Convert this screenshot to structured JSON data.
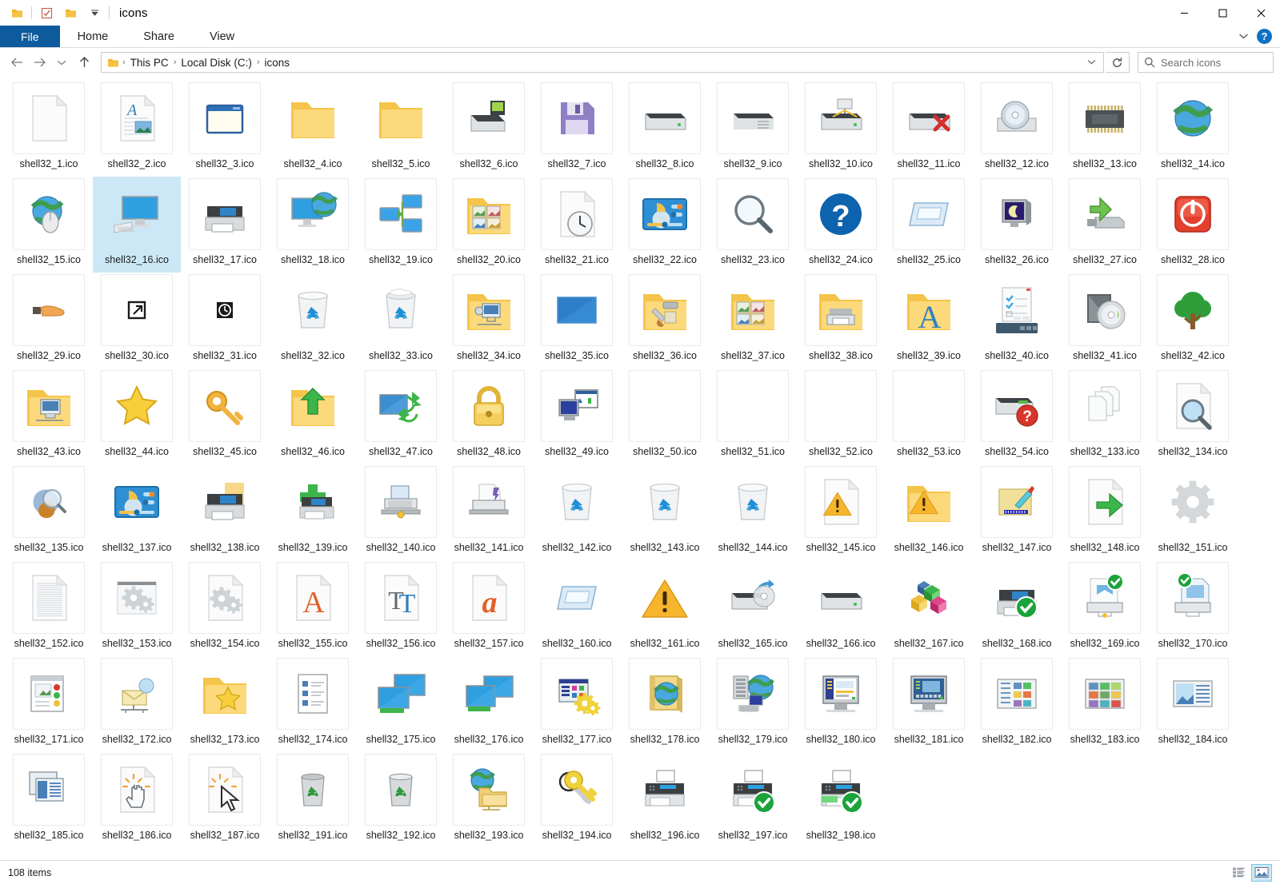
{
  "window": {
    "title": "icons",
    "quick_access": [
      "folder-icon",
      "properties-icon",
      "new-folder-icon",
      "customize-dropdown-icon"
    ],
    "controls": {
      "minimize": "minimize-icon",
      "maximize": "maximize-icon",
      "close": "close-icon"
    }
  },
  "ribbon": {
    "tabs": [
      {
        "label": "File",
        "active": true
      },
      {
        "label": "Home",
        "active": false
      },
      {
        "label": "Share",
        "active": false
      },
      {
        "label": "View",
        "active": false
      }
    ],
    "collapse_icon": "chevron-down-icon",
    "help_label": "?"
  },
  "address": {
    "back_icon": "arrow-left-icon",
    "forward_icon": "arrow-right-icon",
    "recent_icon": "chevron-down-icon",
    "up_icon": "arrow-up-icon",
    "breadcrumb": [
      "This PC",
      "Local Disk (C:)",
      "icons"
    ],
    "breadcrumb_separator": "›",
    "dropdown_icon": "chevron-down-icon",
    "refresh_icon": "refresh-icon"
  },
  "search": {
    "placeholder": "Search icons",
    "icon": "search-icon",
    "value": ""
  },
  "status": {
    "item_count": "108 items",
    "views": [
      {
        "name": "details-view",
        "selected": false
      },
      {
        "name": "large-icons-view",
        "selected": true
      }
    ]
  },
  "files": [
    {
      "label": "shell32_1.ico",
      "icon": "blank-document",
      "selected": false
    },
    {
      "label": "shell32_2.ico",
      "icon": "document-with-text",
      "selected": false
    },
    {
      "label": "shell32_3.ico",
      "icon": "application-window",
      "selected": false
    },
    {
      "label": "shell32_4.ico",
      "icon": "folder-closed",
      "selected": false,
      "nobox": true
    },
    {
      "label": "shell32_5.ico",
      "icon": "folder-closed",
      "selected": false,
      "nobox": true
    },
    {
      "label": "shell32_6.ico",
      "icon": "drive-network",
      "selected": false
    },
    {
      "label": "shell32_7.ico",
      "icon": "floppy-disk",
      "selected": false
    },
    {
      "label": "shell32_8.ico",
      "icon": "hard-drive",
      "selected": false
    },
    {
      "label": "shell32_9.ico",
      "icon": "drive-removable",
      "selected": false
    },
    {
      "label": "shell32_10.ico",
      "icon": "drive-network-share",
      "selected": false
    },
    {
      "label": "shell32_11.ico",
      "icon": "drive-disconnected",
      "selected": false
    },
    {
      "label": "shell32_12.ico",
      "icon": "cd-drive",
      "selected": false
    },
    {
      "label": "shell32_13.ico",
      "icon": "ram-chip",
      "selected": false
    },
    {
      "label": "shell32_14.ico",
      "icon": "globe-internet",
      "selected": false
    },
    {
      "label": "shell32_15.ico",
      "icon": "globe-mouse",
      "selected": false
    },
    {
      "label": "shell32_16.ico",
      "icon": "computer-desktop",
      "selected": true
    },
    {
      "label": "shell32_17.ico",
      "icon": "printer",
      "selected": false
    },
    {
      "label": "shell32_18.ico",
      "icon": "monitor-globe",
      "selected": false
    },
    {
      "label": "shell32_19.ico",
      "icon": "network-screens",
      "selected": false
    },
    {
      "label": "shell32_20.ico",
      "icon": "pictures-folder",
      "selected": false
    },
    {
      "label": "shell32_21.ico",
      "icon": "document-clock",
      "selected": false
    },
    {
      "label": "shell32_22.ico",
      "icon": "control-panel",
      "selected": false
    },
    {
      "label": "shell32_23.ico",
      "icon": "magnifier",
      "selected": false
    },
    {
      "label": "shell32_24.ico",
      "icon": "help-question",
      "selected": false
    },
    {
      "label": "shell32_25.ico",
      "icon": "window-faded",
      "selected": false
    },
    {
      "label": "shell32_26.ico",
      "icon": "monitor-screensaver",
      "selected": false
    },
    {
      "label": "shell32_27.ico",
      "icon": "usb-eject",
      "selected": false
    },
    {
      "label": "shell32_28.ico",
      "icon": "shutdown-power",
      "selected": false
    },
    {
      "label": "shell32_29.ico",
      "icon": "hand-offer",
      "selected": false
    },
    {
      "label": "shell32_30.ico",
      "icon": "shortcut-arrow",
      "selected": false
    },
    {
      "label": "shell32_31.ico",
      "icon": "clock-overlay",
      "selected": false
    },
    {
      "label": "shell32_32.ico",
      "icon": "recycle-empty",
      "selected": false,
      "nobox": true
    },
    {
      "label": "shell32_33.ico",
      "icon": "recycle-full",
      "selected": false,
      "nobox": true
    },
    {
      "label": "shell32_34.ico",
      "icon": "folder-network",
      "selected": false
    },
    {
      "label": "shell32_35.ico",
      "icon": "blue-screen",
      "selected": false
    },
    {
      "label": "shell32_36.ico",
      "icon": "folder-tools",
      "selected": false
    },
    {
      "label": "shell32_37.ico",
      "icon": "pictures-folder",
      "selected": false,
      "nobox": true
    },
    {
      "label": "shell32_38.ico",
      "icon": "folder-printer",
      "selected": false
    },
    {
      "label": "shell32_39.ico",
      "icon": "folder-fonts",
      "selected": false,
      "nobox": true
    },
    {
      "label": "shell32_40.ico",
      "icon": "dialog-taskbar",
      "selected": false,
      "nobox": true
    },
    {
      "label": "shell32_41.ico",
      "icon": "software-cd",
      "selected": false
    },
    {
      "label": "shell32_42.ico",
      "icon": "tree",
      "selected": false
    },
    {
      "label": "shell32_43.ico",
      "icon": "folder-computer",
      "selected": false
    },
    {
      "label": "shell32_44.ico",
      "icon": "star-favorites",
      "selected": false
    },
    {
      "label": "shell32_45.ico",
      "icon": "key-gold",
      "selected": false
    },
    {
      "label": "shell32_46.ico",
      "icon": "folder-up-arrow",
      "selected": false,
      "nobox": true
    },
    {
      "label": "shell32_47.ico",
      "icon": "sync-screens",
      "selected": false
    },
    {
      "label": "shell32_48.ico",
      "icon": "padlock",
      "selected": false
    },
    {
      "label": "shell32_49.ico",
      "icon": "computer-window",
      "selected": false
    },
    {
      "label": "shell32_50.ico",
      "icon": "empty",
      "selected": false
    },
    {
      "label": "shell32_51.ico",
      "icon": "empty",
      "selected": false
    },
    {
      "label": "shell32_52.ico",
      "icon": "empty",
      "selected": false
    },
    {
      "label": "shell32_53.ico",
      "icon": "empty",
      "selected": false
    },
    {
      "label": "shell32_54.ico",
      "icon": "drive-question",
      "selected": false
    },
    {
      "label": "shell32_133.ico",
      "icon": "documents-stack",
      "selected": false
    },
    {
      "label": "shell32_134.ico",
      "icon": "document-search",
      "selected": false
    },
    {
      "label": "shell32_135.ico",
      "icon": "search-results",
      "selected": false
    },
    {
      "label": "shell32_137.ico",
      "icon": "control-panel",
      "selected": false,
      "nobox": true
    },
    {
      "label": "shell32_138.ico",
      "icon": "printer-folder",
      "selected": false,
      "nobox": true
    },
    {
      "label": "shell32_139.ico",
      "icon": "printer-add",
      "selected": false,
      "nobox": true
    },
    {
      "label": "shell32_140.ico",
      "icon": "printer-network",
      "selected": false
    },
    {
      "label": "shell32_141.ico",
      "icon": "printer-file",
      "selected": false
    },
    {
      "label": "shell32_142.ico",
      "icon": "recycle-empty",
      "selected": false,
      "nobox": true
    },
    {
      "label": "shell32_143.ico",
      "icon": "recycle-empty",
      "selected": false,
      "nobox": true
    },
    {
      "label": "shell32_144.ico",
      "icon": "recycle-empty",
      "selected": false,
      "nobox": true
    },
    {
      "label": "shell32_145.ico",
      "icon": "document-warning",
      "selected": false
    },
    {
      "label": "shell32_146.ico",
      "icon": "folder-warning",
      "selected": false,
      "nobox": true
    },
    {
      "label": "shell32_147.ico",
      "icon": "folder-paint",
      "selected": false
    },
    {
      "label": "shell32_148.ico",
      "icon": "document-green-arrow",
      "selected": false
    },
    {
      "label": "shell32_151.ico",
      "icon": "gear-large",
      "selected": false,
      "nobox": true
    },
    {
      "label": "shell32_152.ico",
      "icon": "text-document-lines",
      "selected": false
    },
    {
      "label": "shell32_153.ico",
      "icon": "gears-window",
      "selected": false
    },
    {
      "label": "shell32_154.ico",
      "icon": "gears-document",
      "selected": false
    },
    {
      "label": "shell32_155.ico",
      "icon": "font-file-a",
      "selected": false
    },
    {
      "label": "shell32_156.ico",
      "icon": "truetype-font",
      "selected": false
    },
    {
      "label": "shell32_157.ico",
      "icon": "font-file-lower-a",
      "selected": false
    },
    {
      "label": "shell32_160.ico",
      "icon": "window-faded",
      "selected": false,
      "nobox": true
    },
    {
      "label": "shell32_161.ico",
      "icon": "warning-triangle",
      "selected": false,
      "nobox": true
    },
    {
      "label": "shell32_165.ico",
      "icon": "drive-burn",
      "selected": false,
      "nobox": true
    },
    {
      "label": "shell32_166.ico",
      "icon": "hard-drive",
      "selected": false,
      "nobox": true
    },
    {
      "label": "shell32_167.ico",
      "icon": "colored-blocks",
      "selected": false,
      "nobox": true
    },
    {
      "label": "shell32_168.ico",
      "icon": "printer-check",
      "selected": false,
      "nobox": true
    },
    {
      "label": "shell32_169.ico",
      "icon": "printer-doc-check",
      "selected": false
    },
    {
      "label": "shell32_170.ico",
      "icon": "printer-doc-check2",
      "selected": false
    },
    {
      "label": "shell32_171.ico",
      "icon": "calendar-contacts",
      "selected": false
    },
    {
      "label": "shell32_172.ico",
      "icon": "network-mail",
      "selected": false
    },
    {
      "label": "shell32_173.ico",
      "icon": "folder-star",
      "selected": false,
      "nobox": true
    },
    {
      "label": "shell32_174.ico",
      "icon": "checklist-document",
      "selected": false
    },
    {
      "label": "shell32_175.ico",
      "icon": "screens-green",
      "selected": false,
      "nobox": true
    },
    {
      "label": "shell32_176.ico",
      "icon": "screens-green2",
      "selected": false,
      "nobox": true
    },
    {
      "label": "shell32_177.ico",
      "icon": "window-gears",
      "selected": false
    },
    {
      "label": "shell32_178.ico",
      "icon": "help-book-globe",
      "selected": false
    },
    {
      "label": "shell32_179.ico",
      "icon": "server-network",
      "selected": false
    },
    {
      "label": "shell32_180.ico",
      "icon": "monitor-app",
      "selected": false
    },
    {
      "label": "shell32_181.ico",
      "icon": "monitor-app-blue",
      "selected": false
    },
    {
      "label": "shell32_182.ico",
      "icon": "list-thumbnails",
      "selected": false
    },
    {
      "label": "shell32_183.ico",
      "icon": "grid-thumbnails",
      "selected": false
    },
    {
      "label": "shell32_184.ico",
      "icon": "preview-pane",
      "selected": false
    },
    {
      "label": "shell32_185.ico",
      "icon": "windows-stack",
      "selected": false
    },
    {
      "label": "shell32_186.ico",
      "icon": "document-hand-click",
      "selected": false
    },
    {
      "label": "shell32_187.ico",
      "icon": "document-cursor-click",
      "selected": false
    },
    {
      "label": "shell32_191.ico",
      "icon": "recycle-small-empty",
      "selected": false
    },
    {
      "label": "shell32_192.ico",
      "icon": "recycle-small-full",
      "selected": false
    },
    {
      "label": "shell32_193.ico",
      "icon": "globe-folders",
      "selected": false
    },
    {
      "label": "shell32_194.ico",
      "icon": "keys-pair",
      "selected": false
    },
    {
      "label": "shell32_196.ico",
      "icon": "fax-machine",
      "selected": false,
      "nobox": true
    },
    {
      "label": "shell32_197.ico",
      "icon": "fax-check",
      "selected": false,
      "nobox": true
    },
    {
      "label": "shell32_198.ico",
      "icon": "fax-check-green",
      "selected": false,
      "nobox": true
    }
  ]
}
